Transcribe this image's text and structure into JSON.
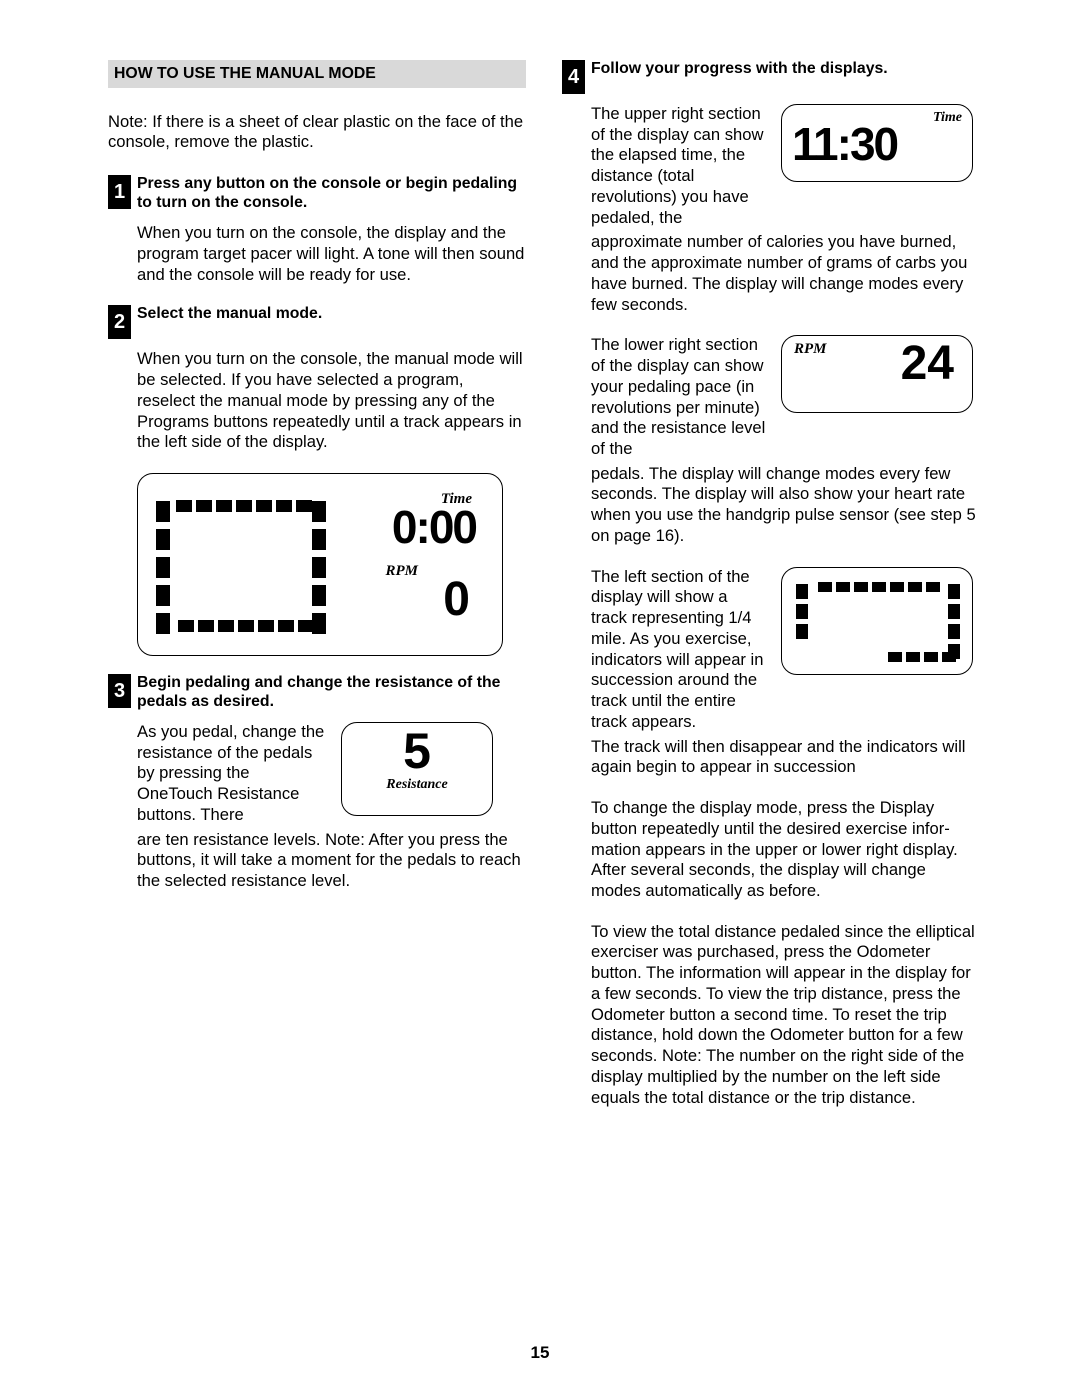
{
  "section_title": "HOW TO USE THE MANUAL MODE",
  "note": "Note: If there is a sheet of clear plastic on the face of the console, remove the plastic.",
  "steps": {
    "s1": {
      "num": "1",
      "head": "Press any button on the console or begin pedaling to turn on the console.",
      "body": "When you turn on the console, the display and the program target pacer will light. A tone will then sound and the console will be ready for use."
    },
    "s2": {
      "num": "2",
      "head": "Select the manual mode.",
      "body": "When you turn on the console, the manual mode will be selected. If you have selected a program, reselect the manual mode by pressing any of the Programs buttons repeatedly until a track appears in the left side of the display."
    },
    "s3": {
      "num": "3",
      "head": "Begin pedaling and change the resistance of the pedals as desired.",
      "body_a": "As you pedal, change the resis­tance of the pedals by pressing the OneTouch Resis­tance buttons. There",
      "body_b": "are ten resistance levels. Note: After you press the buttons, it will take a moment for the pedals to reach the selected resistance level."
    },
    "s4": {
      "num": "4",
      "head": "Follow your progress with the displays.",
      "p1a": "The upper right sec­tion of the display can show the elapsed time, the distance (total revolutions) you have pedaled, the",
      "p1b": "approximate number of calories you have burned, and the approximate number of grams of carbs you have burned. The display will change modes every few seconds.",
      "p2a": "The lower right sec­tion of the display can show your pedaling pace (in revolutions per minute) and the resistance level of the",
      "p2b": "pedals. The display will change modes every few seconds. The display will also show your heart rate when you use the handgrip pulse sensor (see step 5 on page 16).",
      "p3a": "The left section of the display will show a track representing 1/4 mile. As you exercise, indicators will appear in succession around the track until the entire track appears.",
      "p3b": "The track will then disappear and the indicators will again begin to appear in succession",
      "p4": "To change the display mode, press the Display button repeatedly until the desired exercise infor­mation appears in the upper or lower right display. After several seconds, the display will change modes automatically as before.",
      "p5": "To view the total distance pedaled since the ellipti­cal exerciser was purchased, press the Odometer button. The information will appear in the display for a few seconds. To view the trip distance, press the Odometer button a second time. To reset the trip distance, hold down the Odometer button for a few seconds. Note: The number on the right side of the display multiplied by the number on the left side equals the total distance or the trip distance."
    }
  },
  "labels": {
    "time": "Time",
    "rpm": "RPM",
    "resistance": "Resistance"
  },
  "display_values": {
    "big_time": "0:00",
    "big_rpm": "0",
    "resistance": "5",
    "time_small": "11:30",
    "rpm_small": "24"
  },
  "page_number": "15"
}
